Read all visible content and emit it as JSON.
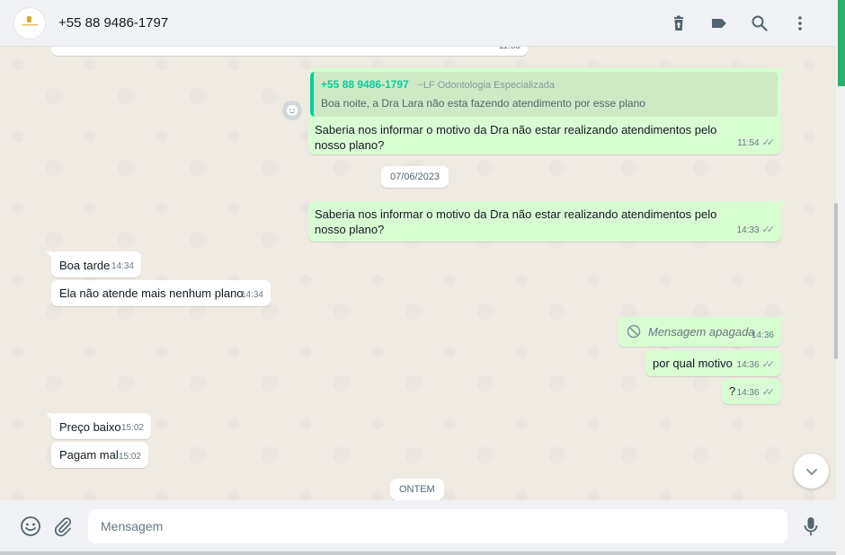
{
  "header": {
    "contact_name": "+55 88 9486-1797",
    "icons": [
      "delete-icon",
      "label-icon",
      "search-icon",
      "menu-icon"
    ]
  },
  "messages": {
    "top_partial_time": "11:53",
    "quoted": {
      "author": "+55 88 9486-1797",
      "group": "~LF Odontologia Especializada",
      "text": "Boa noite, a Dra Lara não esta fazendo atendimento por esse plano"
    },
    "m1": {
      "text": "Saberia nos informar o motivo da Dra não estar realizando atendimentos pelo nosso plano?",
      "time": "11:54"
    },
    "date1": "07/06/2023",
    "m2": {
      "text": "Saberia nos informar o motivo da Dra não estar realizando atendimentos pelo nosso plano?",
      "time": "14:33"
    },
    "m3": {
      "text": "Boa tarde",
      "time": "14:34"
    },
    "m4": {
      "text": "Ela não atende mais nenhum plano",
      "time": "14:34"
    },
    "m5": {
      "text": "Mensagem apagada",
      "time": "14:36"
    },
    "m6": {
      "text": "por qual motivo",
      "time": "14:36"
    },
    "m7": {
      "text": "?",
      "time": "14:36"
    },
    "m8": {
      "text": "Preço baixo",
      "time": "15:02"
    },
    "m9": {
      "text": "Pagam mal",
      "time": "15:02"
    },
    "date2": "ONTEM"
  },
  "footer": {
    "placeholder": "Mensagem"
  },
  "colors": {
    "outgoing_bubble": "#d9fdd3",
    "incoming_bubble": "#ffffff",
    "accent": "#06cf9c",
    "chat_bg": "#efeae2"
  }
}
